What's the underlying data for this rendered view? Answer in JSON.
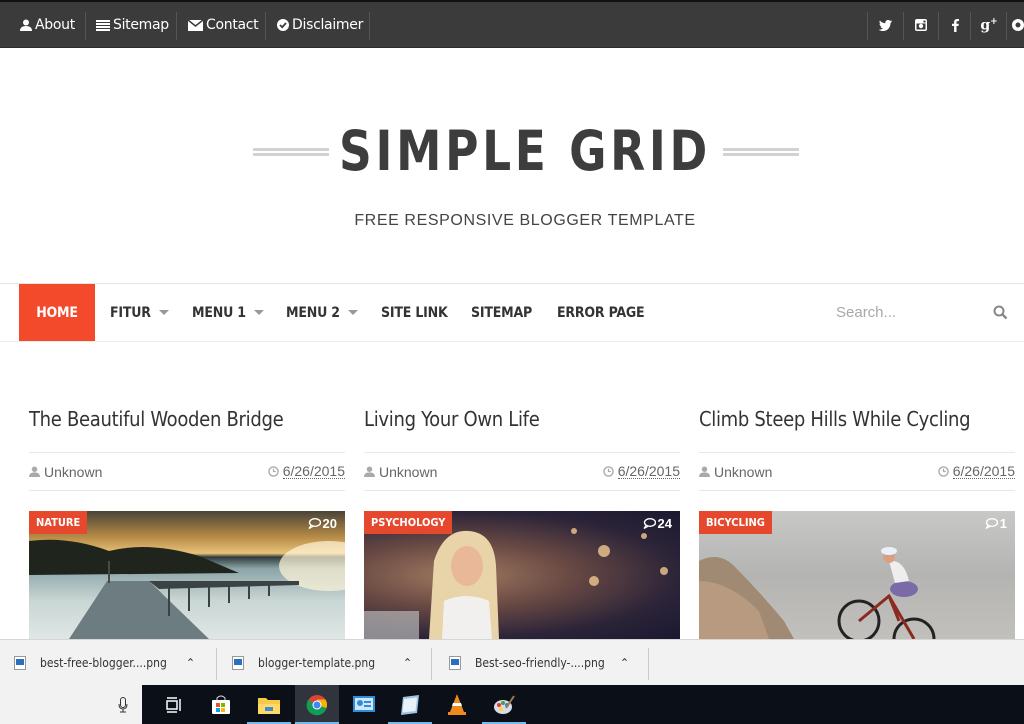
{
  "topbar": {
    "links": [
      {
        "label": "About",
        "icon": "user-icon"
      },
      {
        "label": "Sitemap",
        "icon": "list-icon"
      },
      {
        "label": "Contact",
        "icon": "envelope-icon"
      },
      {
        "label": "Disclaimer",
        "icon": "check-circle-icon"
      }
    ],
    "social": [
      "twitter-icon",
      "instagram-icon",
      "facebook-icon",
      "google-plus-icon",
      "pinterest-icon"
    ]
  },
  "header": {
    "title": "SIMPLE GRID",
    "description": "FREE RESPONSIVE BLOGGER TEMPLATE"
  },
  "nav": {
    "items": [
      {
        "label": "HOME",
        "active": true,
        "dropdown": false
      },
      {
        "label": "FITUR",
        "dropdown": true
      },
      {
        "label": "MENU 1",
        "dropdown": true
      },
      {
        "label": "MENU 2",
        "dropdown": true
      },
      {
        "label": "SITE LINK",
        "dropdown": false
      },
      {
        "label": "SITEMAP",
        "dropdown": false
      },
      {
        "label": "ERROR PAGE",
        "dropdown": false
      }
    ],
    "search_placeholder": "Search...",
    "accent": "#f44a2c"
  },
  "posts": [
    {
      "title": "The Beautiful Wooden Bridge",
      "author": "Unknown",
      "date": "6/26/2015",
      "category": "NATURE",
      "comments": "20"
    },
    {
      "title": "Living Your Own Life",
      "author": "Unknown",
      "date": "6/26/2015",
      "category": "PSYCHOLOGY",
      "comments": "24"
    },
    {
      "title": "Climb Steep Hills While Cycling",
      "author": "Unknown",
      "date": "6/26/2015",
      "category": "BICYCLING",
      "comments": "1"
    }
  ],
  "downloads": [
    {
      "name": "best-free-blogger....png"
    },
    {
      "name": "blogger-template.png"
    },
    {
      "name": "Best-seo-friendly-....png"
    }
  ],
  "taskbar": {
    "apps": [
      "task-view-icon",
      "store-icon",
      "file-explorer-icon",
      "chrome-icon",
      "remote-desktop-icon",
      "notepad-icon",
      "vlc-icon",
      "paint-icon"
    ]
  }
}
